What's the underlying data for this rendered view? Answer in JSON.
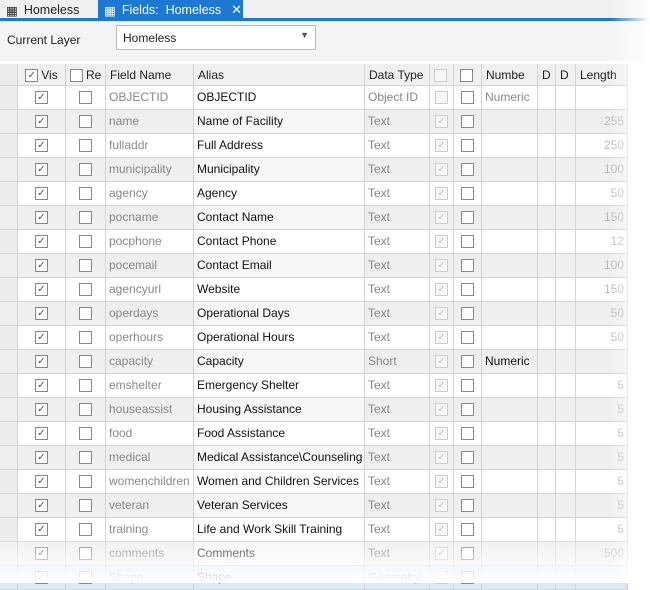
{
  "tabs": [
    {
      "label": "Homeless",
      "icon": "table-icon"
    },
    {
      "label": "Fields:  Homeless",
      "icon": "fields-icon",
      "close": "✕"
    }
  ],
  "layer": {
    "label": "Current Layer",
    "value": "Homeless"
  },
  "headers": [
    "Vis",
    "Re",
    "Field Name",
    "Alias",
    "Data Type",
    "",
    "",
    "Numbe",
    "D",
    "D",
    "Length"
  ],
  "rows": [
    [
      "OBJECTID",
      "OBJECTID",
      "Object ID",
      "Numeric",
      ""
    ],
    [
      "name",
      "Name of Facility",
      "Text",
      "",
      "255"
    ],
    [
      "fulladdr",
      "Full Address",
      "Text",
      "",
      "250"
    ],
    [
      "municipality",
      "Municipality",
      "Text",
      "",
      "100"
    ],
    [
      "agency",
      "Agency",
      "Text",
      "",
      "50"
    ],
    [
      "pocname",
      "Contact Name",
      "Text",
      "",
      "150"
    ],
    [
      "pocphone",
      "Contact Phone",
      "Text",
      "",
      "12"
    ],
    [
      "pocemail",
      "Contact Email",
      "Text",
      "",
      "100"
    ],
    [
      "agencyurl",
      "Website",
      "Text",
      "",
      "150"
    ],
    [
      "operdays",
      "Operational Days",
      "Text",
      "",
      "50"
    ],
    [
      "operhours",
      "Operational Hours",
      "Text",
      "",
      "50"
    ],
    [
      "capacity",
      "Capacity",
      "Short",
      "Numeric",
      ""
    ],
    [
      "emshelter",
      "Emergency Shelter",
      "Text",
      "",
      "5"
    ],
    [
      "houseassist",
      "Housing Assistance",
      "Text",
      "",
      "5"
    ],
    [
      "food",
      "Food Assistance",
      "Text",
      "",
      "5"
    ],
    [
      "medical",
      "Medical Assistance\\Counseling",
      "Text",
      "",
      "5"
    ],
    [
      "womenchildren",
      "Women and Children Services",
      "Text",
      "",
      "5"
    ],
    [
      "veteran",
      "Veteran Services",
      "Text",
      "",
      "5"
    ],
    [
      "training",
      "Life and Work Skill Training",
      "Text",
      "",
      "5"
    ],
    [
      "comments",
      "Comments",
      "Text",
      "",
      "500"
    ],
    [
      "Shape",
      "Shape",
      "Geometry",
      "",
      ""
    ]
  ],
  "accent": "#1c78d0"
}
